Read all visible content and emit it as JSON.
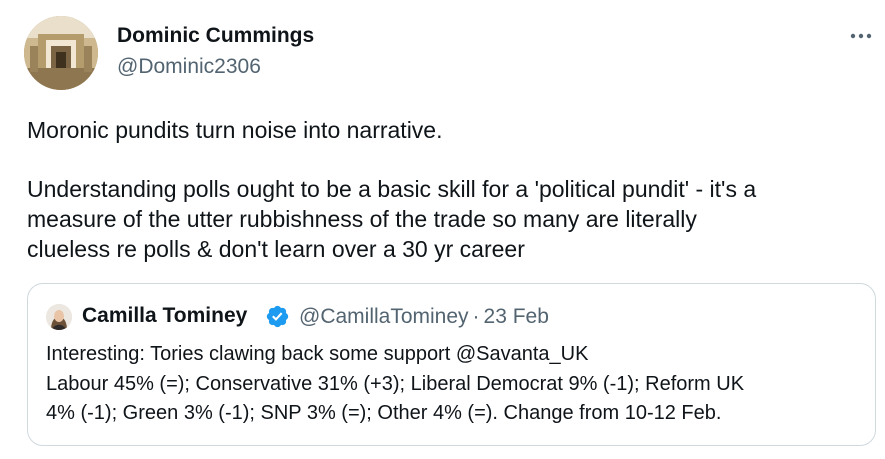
{
  "tweet": {
    "author_name": "Dominic Cummings",
    "author_handle": "@Dominic2306",
    "more_icon": "more-horizontal-icon",
    "lines": [
      "Moronic pundits turn noise into narrative.",
      "Understanding polls ought to be a basic skill for a 'political pundit' - it's a",
      "measure of the utter rubbishness of the trade so many are literally",
      "clueless re polls & don't learn over a 30 yr career"
    ]
  },
  "quote": {
    "author_name": "Camilla Tominey",
    "verified_icon": "verified-badge-icon",
    "author_handle": "@CamillaTominey",
    "separator": "·",
    "date": "23 Feb",
    "lines": [
      "Interesting: Tories clawing back some support @Savanta_UK",
      "Labour 45% (=); Conservative 31% (+3); Liberal Democrat 9% (-1); Reform UK",
      "4% (-1); Green 3% (-1); SNP 3% (=); Other 4% (=). Change from 10-12 Feb."
    ]
  },
  "colors": {
    "text_primary": "#0f1419",
    "text_secondary": "#536471",
    "border": "#cfd9de",
    "verified_blue": "#1d9bf0"
  }
}
